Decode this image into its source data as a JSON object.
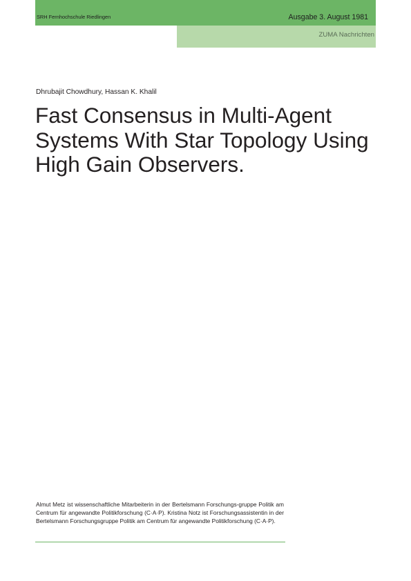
{
  "header": {
    "institution": "SRH Fernhochschule Riedlingen",
    "issue": "Ausgabe 3. August 1981",
    "journal": "ZUMA Nachrichten",
    "accent_color": "#6cb565",
    "secondary_color": "#b7d9aa"
  },
  "article": {
    "authors": "Dhrubajit Chowdhury, Hassan K. Khalil",
    "title": "Fast Consensus in Multi-Agent\nSystems With Star Topology Using\nHigh Gain Observers."
  },
  "footnote": {
    "text": "Almut Metz ist wissenschaftliche Mitarbeiterin in der Bertelsmann Forschungs-gruppe Politik am Centrum für angewandte Politikforschung (C·A·P). Kristina Notz ist Forschungsassistentin in der Bertelsmann Forschungsgruppe Politik am Centrum für angewandte Politikforschung (C·A·P)."
  }
}
